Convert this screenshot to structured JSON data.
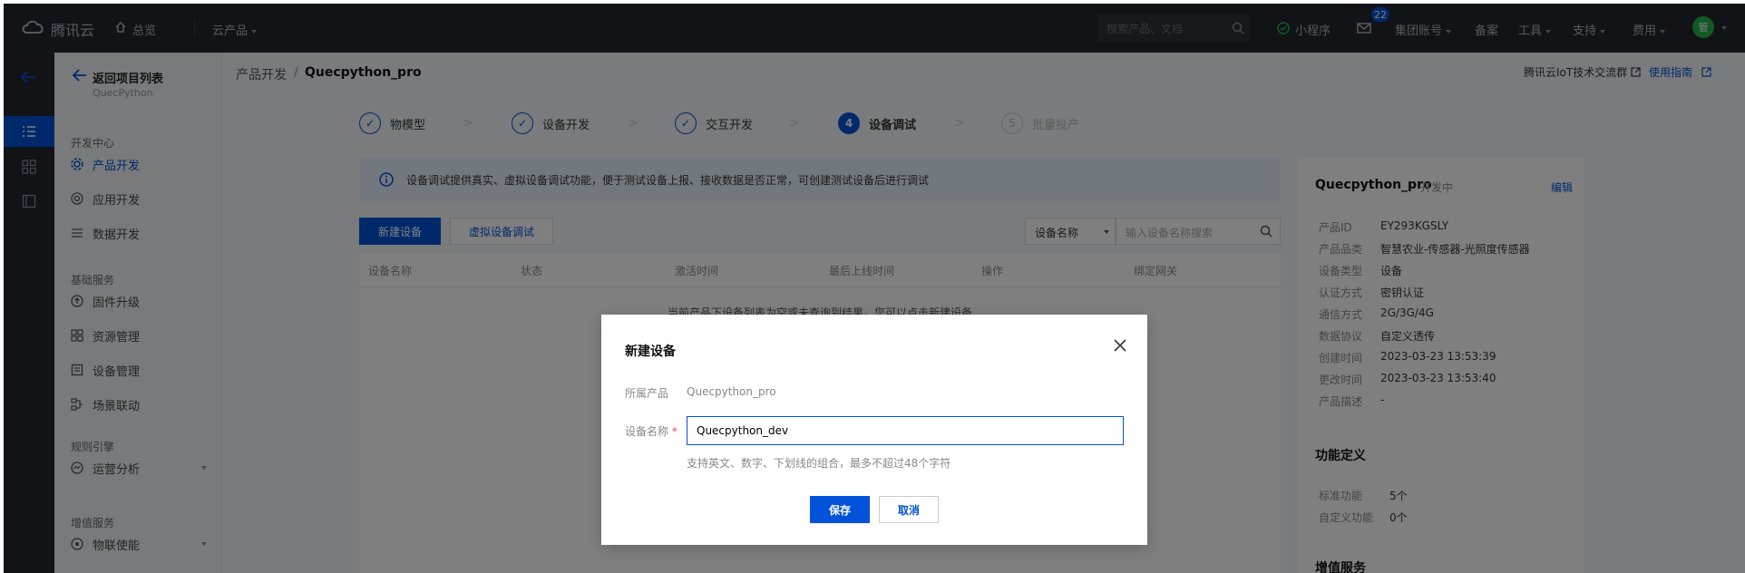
{
  "topbar": {
    "logo_text": "腾讯云",
    "home": "总览",
    "products": "云产品",
    "search_placeholder": "搜索产品、文档",
    "mini_program": "小程序",
    "mail_badge": "22",
    "group_account": "集团账号",
    "beian": "备案",
    "tools": "工具",
    "support": "支持",
    "billing": "费用",
    "avatar": "管"
  },
  "sidebar": {
    "back": "返回项目列表",
    "project": "QuecPython",
    "sections": [
      {
        "title": "开发中心",
        "items": [
          "产品开发",
          "应用开发",
          "数据开发"
        ]
      },
      {
        "title": "基础服务",
        "items": [
          "固件升级",
          "资源管理",
          "设备管理",
          "场景联动"
        ]
      },
      {
        "title": "规则引擎",
        "items": [
          "运营分析"
        ]
      },
      {
        "title": "增值服务",
        "items": [
          "物联使能"
        ]
      }
    ],
    "active": "产品开发"
  },
  "main": {
    "breadcrumb_parent": "产品开发",
    "breadcrumb_sep": "/",
    "breadcrumb_current": "Quecpython_pro",
    "top_link1": "腾讯云IoT技术交流群",
    "top_link2": "使用指南",
    "steps": [
      {
        "num": "✓",
        "label": "物模型"
      },
      {
        "num": "✓",
        "label": "设备开发"
      },
      {
        "num": "✓",
        "label": "交互开发"
      },
      {
        "num": "4",
        "label": "设备调试"
      },
      {
        "num": "5",
        "label": "批量投产"
      }
    ],
    "notice": "设备调试提供真实、虚拟设备调试功能，便于测试设备上报、接收数据是否正常，可创建测试设备后进行调试",
    "new_device_btn": "新建设备",
    "virtual_debug_btn": "虚拟设备调试",
    "filter_select": "设备名称",
    "filter_placeholder": "输入设备名称搜索",
    "table_headers": [
      "设备名称",
      "状态",
      "激活时间",
      "最后上线时间",
      "操作",
      "绑定网关"
    ],
    "empty_text": "当前产品下设备列表为空或未查询到结果，您可以点击新建设备"
  },
  "product_info": {
    "name": "Quecpython_pro",
    "status": "开发中",
    "edit": "编辑",
    "rows": [
      {
        "k": "产品ID",
        "v": "EY293KGSLY"
      },
      {
        "k": "产品品类",
        "v": "智慧农业-传感器-光照度传感器"
      },
      {
        "k": "设备类型",
        "v": "设备"
      },
      {
        "k": "认证方式",
        "v": "密钥认证"
      },
      {
        "k": "通信方式",
        "v": "2G/3G/4G"
      },
      {
        "k": "数据协议",
        "v": "自定义透传"
      },
      {
        "k": "创建时间",
        "v": "2023-03-23 13:53:39"
      },
      {
        "k": "更改时间",
        "v": "2023-03-23 13:53:40"
      },
      {
        "k": "产品描述",
        "v": "-"
      }
    ],
    "func_title": "功能定义",
    "func_rows": [
      {
        "k": "标准功能",
        "v": "5个"
      },
      {
        "k": "自定义功能",
        "v": "0个"
      }
    ],
    "value_added_title": "增值服务"
  },
  "modal": {
    "title": "新建设备",
    "product_label": "所属产品",
    "product_value": "Quecpython_pro",
    "name_label": "设备名称",
    "required_mark": "*",
    "name_value": "Quecpython_dev",
    "hint": "支持英文、数字、下划线的组合，最多不超过48个字符",
    "save": "保存",
    "cancel": "取消"
  }
}
